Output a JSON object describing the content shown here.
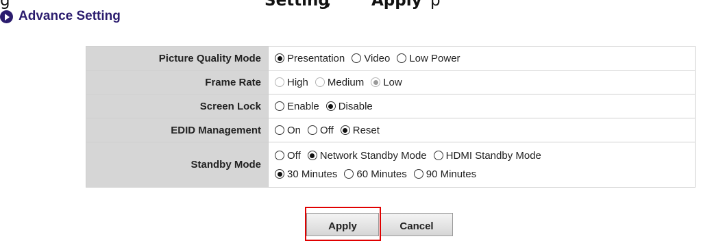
{
  "top_crop": {
    "parts": [
      "g",
      "Setting",
      ", ",
      "Apply",
      "p"
    ]
  },
  "section": {
    "title": "Advance Setting"
  },
  "settings": [
    {
      "label": "Picture Quality Mode",
      "options": [
        {
          "text": "Presentation",
          "selected": true,
          "disabled": false
        },
        {
          "text": "Video",
          "selected": false,
          "disabled": false
        },
        {
          "text": "Low Power",
          "selected": false,
          "disabled": false
        }
      ]
    },
    {
      "label": "Frame Rate",
      "options": [
        {
          "text": "High",
          "selected": false,
          "disabled": true
        },
        {
          "text": "Medium",
          "selected": false,
          "disabled": true
        },
        {
          "text": "Low",
          "selected": true,
          "disabled": true
        }
      ]
    },
    {
      "label": "Screen Lock",
      "options": [
        {
          "text": "Enable",
          "selected": false,
          "disabled": false
        },
        {
          "text": "Disable",
          "selected": true,
          "disabled": false
        }
      ]
    },
    {
      "label": "EDID Management",
      "options": [
        {
          "text": "On",
          "selected": false,
          "disabled": false
        },
        {
          "text": "Off",
          "selected": false,
          "disabled": false
        },
        {
          "text": "Reset",
          "selected": true,
          "disabled": false
        }
      ]
    },
    {
      "label": "Standby Mode",
      "lines": [
        [
          {
            "text": "Off",
            "selected": false,
            "disabled": false
          },
          {
            "text": "Network Standby Mode",
            "selected": true,
            "disabled": false
          },
          {
            "text": "HDMI Standby Mode",
            "selected": false,
            "disabled": false
          }
        ],
        [
          {
            "text": "30 Minutes",
            "selected": true,
            "disabled": false
          },
          {
            "text": "60 Minutes",
            "selected": false,
            "disabled": false
          },
          {
            "text": "90 Minutes",
            "selected": false,
            "disabled": false
          }
        ]
      ]
    }
  ],
  "buttons": {
    "apply": "Apply",
    "cancel": "Cancel"
  },
  "colors": {
    "accent": "#2b1c6e",
    "label_bg": "#d6d6d6",
    "highlight": "#e00000"
  }
}
